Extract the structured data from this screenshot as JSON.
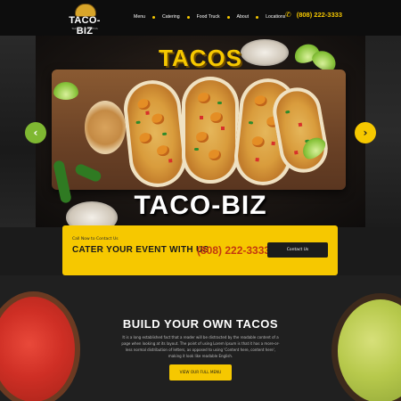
{
  "header": {
    "logo_text": "TACO-BIZ",
    "logo_sub": "TACOS & BURRITOS",
    "nav": [
      "Menu",
      "Catering",
      "Food Truck",
      "About",
      "Locations"
    ],
    "phone": "(808) 222-3333"
  },
  "hero": {
    "title": "TACOS",
    "brand": "TACO-BIZ",
    "prev_arrow": "‹",
    "next_arrow": "›"
  },
  "cta": {
    "eyebrow": "Call Now to Contact Us",
    "title": "CATER YOUR EVENT WITH US",
    "phone": "(808) 222-3333",
    "button_label": "Contact Us"
  },
  "build": {
    "title": "BUILD YOUR OWN TACOS",
    "body": "It is a long established fact that a reader will be distracted by the readable content of a page when looking at its layout. The point of using Lorem Ipsum is that it has a more-or-less normal distribution of letters, as opposed to using 'Content here, content here', making it look like readable English.",
    "button_label": "VIEW OUR FULL MENU"
  },
  "colors": {
    "accent": "#f6c800",
    "green": "#7fb832",
    "dark": "#1b1b1b",
    "phone_red": "#c4380f"
  },
  "icons": {
    "phone": "phone-icon",
    "prev": "chevron-left-icon",
    "next": "chevron-right-icon"
  }
}
